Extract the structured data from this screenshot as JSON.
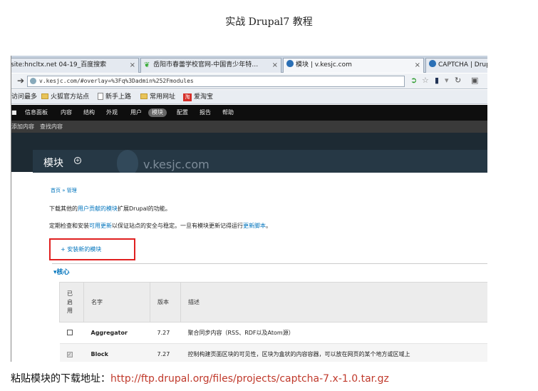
{
  "doc_title": "实战 Drupal7 教程",
  "browser": {
    "tabs": [
      {
        "label": "site:hncltx.net 04-19_百度搜索"
      },
      {
        "label": "岳阳市春蕾学校官网-中国青少年特…"
      },
      {
        "label": "模块 | v.kesjc.com"
      },
      {
        "label": "CAPTCHA | Drupal.org"
      }
    ],
    "url": "v.kesjc.com/#overlay=%3Fq%3Dadmin%252Fmodules",
    "bookmarks": [
      "访问最多",
      "火狐官方站点",
      "新手上路",
      "常用网址",
      "爱淘宝"
    ],
    "bookmark_badge": "淘"
  },
  "drupal": {
    "toolbar": [
      "信息面板",
      "内容",
      "结构",
      "外观",
      "用户",
      "模块",
      "配置",
      "报告",
      "帮助"
    ],
    "shortcuts": [
      "添加内容",
      "查找内容"
    ],
    "watermark": "v.kesjc.com",
    "overlay_title": "模块",
    "breadcrumb": "首页 » 管理",
    "p1": {
      "before": "下载其他的",
      "link": "用户贡献的模块",
      "after": "扩展Drupal的功能。"
    },
    "p2": {
      "before": "定期检查和安装",
      "link1": "可用更新",
      "mid": "以保证站点的安全与稳定。一旦有模块更新记得运行",
      "link2": "更新脚本",
      "after": "。"
    },
    "install_link": "+ 安装新的模块",
    "section": "▾核心",
    "table": {
      "headers": [
        "已\n启\n用",
        "名字",
        "版本",
        "描述"
      ],
      "rows": [
        {
          "name": "Aggregator",
          "version": "7.27",
          "desc": "聚合同步内容（RSS、RDF以及Atom源）",
          "enabled": false
        },
        {
          "name": "Block",
          "version": "7.27",
          "desc": "控制构建页面区块的可见性，区块为盒状的内容容器，可以放在网页的某个地方或区域上",
          "desc2": "",
          "enabled": true
        }
      ]
    }
  },
  "footer": {
    "label": "粘贴模块的下载地址：",
    "url": "http://ftp.drupal.org/files/projects/captcha-7.x-1.0.tar.gz"
  }
}
